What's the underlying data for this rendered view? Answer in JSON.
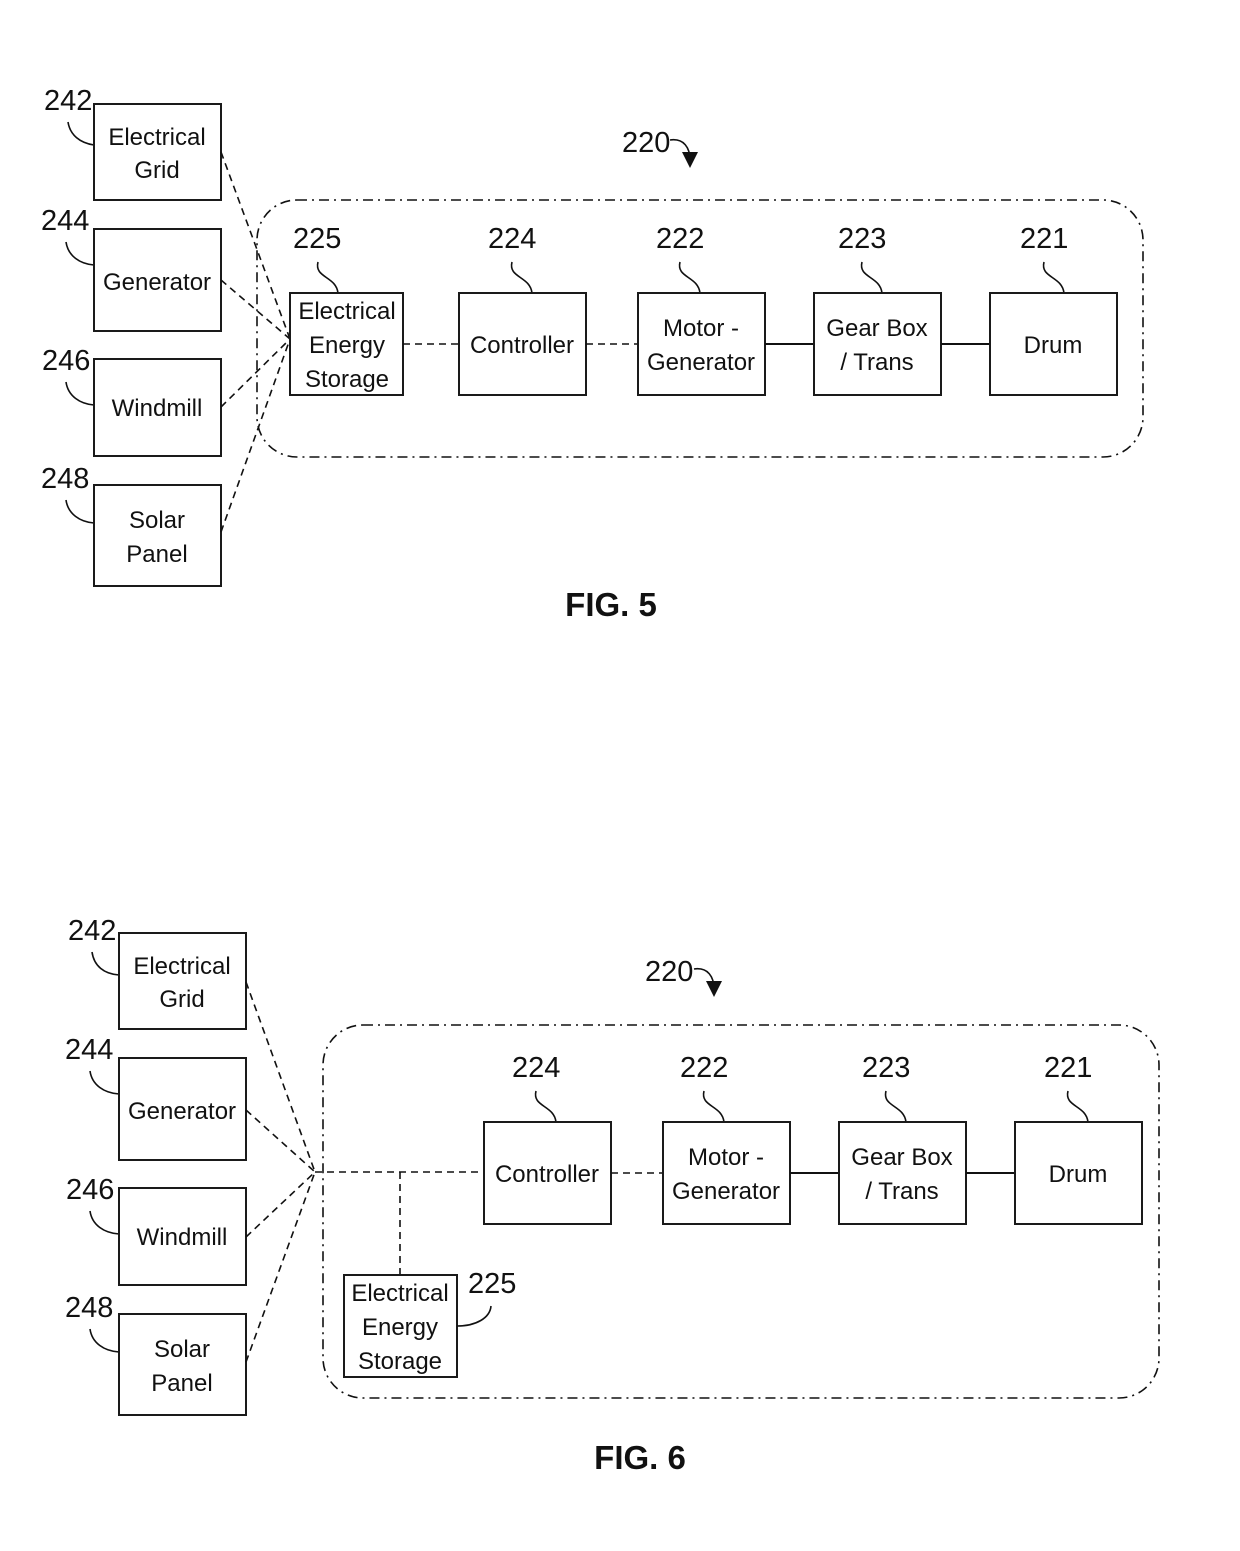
{
  "figures": [
    {
      "caption": "FIG. 5",
      "system_ref": "220",
      "sources": [
        {
          "ref": "242",
          "line1": "Electrical",
          "line2": "Grid"
        },
        {
          "ref": "244",
          "line1": "Generator",
          "line2": ""
        },
        {
          "ref": "246",
          "line1": "Windmill",
          "line2": ""
        },
        {
          "ref": "248",
          "line1": "Solar",
          "line2": "Panel"
        }
      ],
      "components": {
        "storage": {
          "ref": "225",
          "line1": "Electrical",
          "line2": "Energy",
          "line3": "Storage"
        },
        "controller": {
          "ref": "224",
          "line1": "Controller"
        },
        "motor": {
          "ref": "222",
          "line1": "Motor -",
          "line2": "Generator"
        },
        "gearbox": {
          "ref": "223",
          "line1": "Gear Box",
          "line2": "/ Trans"
        },
        "drum": {
          "ref": "221",
          "line1": "Drum"
        }
      }
    },
    {
      "caption": "FIG. 6",
      "system_ref": "220",
      "sources": [
        {
          "ref": "242",
          "line1": "Electrical",
          "line2": "Grid"
        },
        {
          "ref": "244",
          "line1": "Generator",
          "line2": ""
        },
        {
          "ref": "246",
          "line1": "Windmill",
          "line2": ""
        },
        {
          "ref": "248",
          "line1": "Solar",
          "line2": "Panel"
        }
      ],
      "components": {
        "storage": {
          "ref": "225",
          "line1": "Electrical",
          "line2": "Energy",
          "line3": "Storage"
        },
        "controller": {
          "ref": "224",
          "line1": "Controller"
        },
        "motor": {
          "ref": "222",
          "line1": "Motor -",
          "line2": "Generator"
        },
        "gearbox": {
          "ref": "223",
          "line1": "Gear Box",
          "line2": "/ Trans"
        },
        "drum": {
          "ref": "221",
          "line1": "Drum"
        }
      }
    }
  ]
}
